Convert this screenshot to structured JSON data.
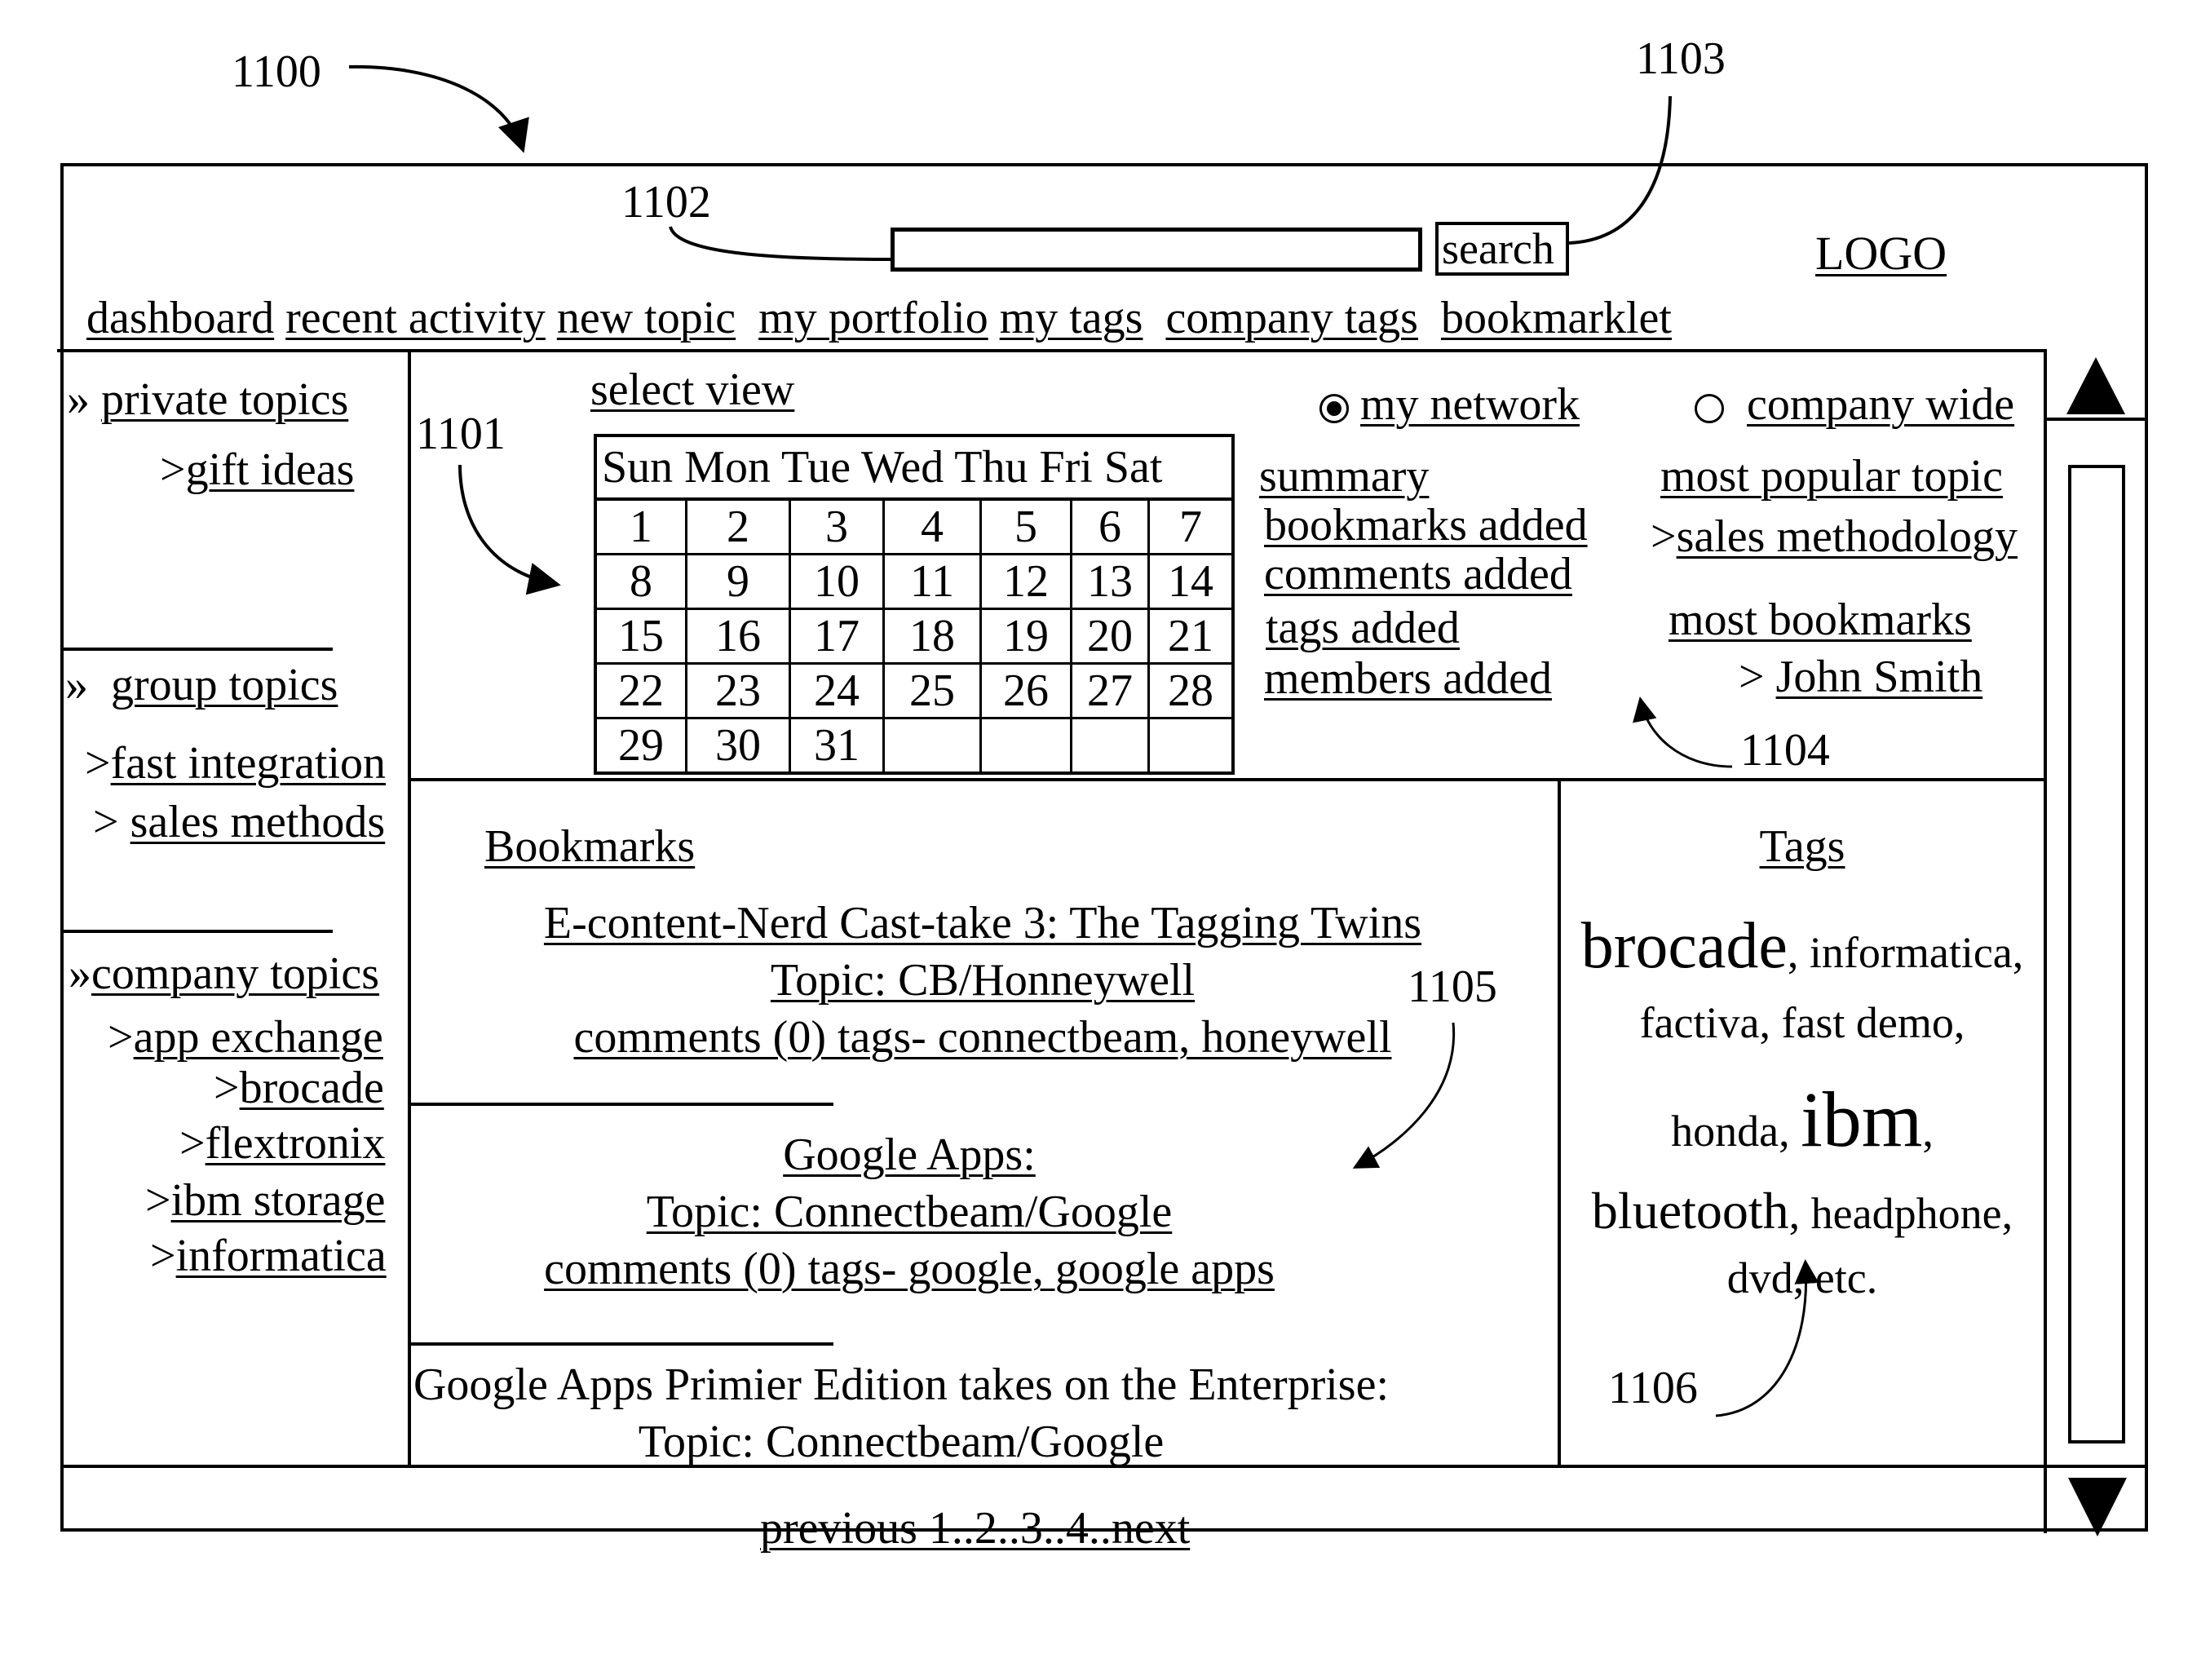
{
  "figure_refs": {
    "r1100": "1100",
    "r1101": "1101",
    "r1102": "1102",
    "r1103": "1103",
    "r1104": "1104",
    "r1105": "1105",
    "r1106": "1106"
  },
  "header": {
    "search_value": "",
    "search_button": "search",
    "logo": "LOGO",
    "nav": [
      "dashboard",
      "recent activity",
      "new topic",
      "my portfolio",
      "my tags",
      "company tags",
      "bookmarklet"
    ]
  },
  "sidebar": {
    "private": {
      "title": "private topics",
      "items": [
        "gift ideas"
      ]
    },
    "group": {
      "title": "group topics",
      "items": [
        "fast integration",
        "sales methods"
      ]
    },
    "company": {
      "title": "company topics",
      "items": [
        "app exchange",
        "brocade",
        "flextronix",
        "ibm storage",
        "informatica"
      ]
    }
  },
  "calendar": {
    "select_view": "select view",
    "days": [
      "Sun",
      "Mon",
      "Tue",
      "Wed",
      "Thu",
      "Fri",
      "Sat"
    ],
    "weeks": [
      [
        "1",
        "2",
        "3",
        "4",
        "5",
        "6",
        "7"
      ],
      [
        "8",
        "9",
        "10",
        "11",
        "12",
        "13",
        "14"
      ],
      [
        "15",
        "16",
        "17",
        "18",
        "19",
        "20",
        "21"
      ],
      [
        "22",
        "23",
        "24",
        "25",
        "26",
        "27",
        "28"
      ],
      [
        "29",
        "30",
        "31",
        "",
        "",
        "",
        ""
      ]
    ]
  },
  "scope": {
    "my_network": "my network",
    "company_wide": "company wide",
    "selected": "my network"
  },
  "summary": {
    "title": "summary",
    "items": [
      "bookmarks added",
      "comments added",
      "tags added",
      "members added"
    ]
  },
  "popular": {
    "topic_title": "most popular topic",
    "topic": "sales methodology",
    "bookmarks_title": "most bookmarks",
    "bookmarks_user": "John Smith"
  },
  "bookmarks": {
    "title": "Bookmarks",
    "entries": [
      {
        "title": "E-content-Nerd Cast-take 3: The Tagging Twins",
        "topic": "Topic:  CB/Honneywell",
        "meta": "comments (0) tags- connectbeam, honeywell"
      },
      {
        "title": "Google Apps:",
        "topic": "Topic:  Connectbeam/Google",
        "meta": "comments (0) tags- google, google apps"
      },
      {
        "title": "Google Apps Primier Edition takes on the Enterprise:",
        "topic": "Topic:  Connectbeam/Google",
        "meta": ""
      }
    ]
  },
  "tags": {
    "title": "Tags",
    "cloud": [
      {
        "text": "brocade",
        "weight": "xl"
      },
      {
        "text": "informatica",
        "weight": "m"
      },
      {
        "text": "factiva",
        "weight": "m"
      },
      {
        "text": "fast demo",
        "weight": "m"
      },
      {
        "text": "honda",
        "weight": "m"
      },
      {
        "text": "ibm",
        "weight": "xxl"
      },
      {
        "text": "bluetooth",
        "weight": "l"
      },
      {
        "text": "headphone",
        "weight": "m"
      },
      {
        "text": "dvd",
        "weight": "m"
      },
      {
        "text": "etc.",
        "weight": "m"
      }
    ]
  },
  "pager": {
    "label": "previous 1..2..3..4..next"
  }
}
